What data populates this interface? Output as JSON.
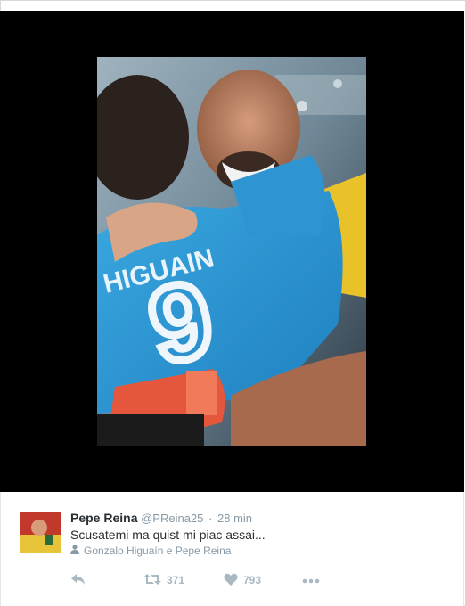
{
  "tweet": {
    "name": "Pepe Reina",
    "handle": "@PReina25",
    "separator": "·",
    "time": "28 min",
    "text": "Scusatemi ma quist mi piac assai...",
    "tagged": "Gonzalo Higuaín e Pepe Reina",
    "actions": {
      "retweets": "371",
      "likes": "793"
    }
  },
  "photo": {
    "jersey_name": "HIGUAIN",
    "jersey_number": "9"
  },
  "colors": {
    "text_primary": "#292f33",
    "text_secondary": "#8899a6",
    "media_background": "#000000"
  },
  "icons": [
    "reply-icon",
    "retweet-icon",
    "like-icon",
    "more-icon",
    "person-tag-icon"
  ]
}
